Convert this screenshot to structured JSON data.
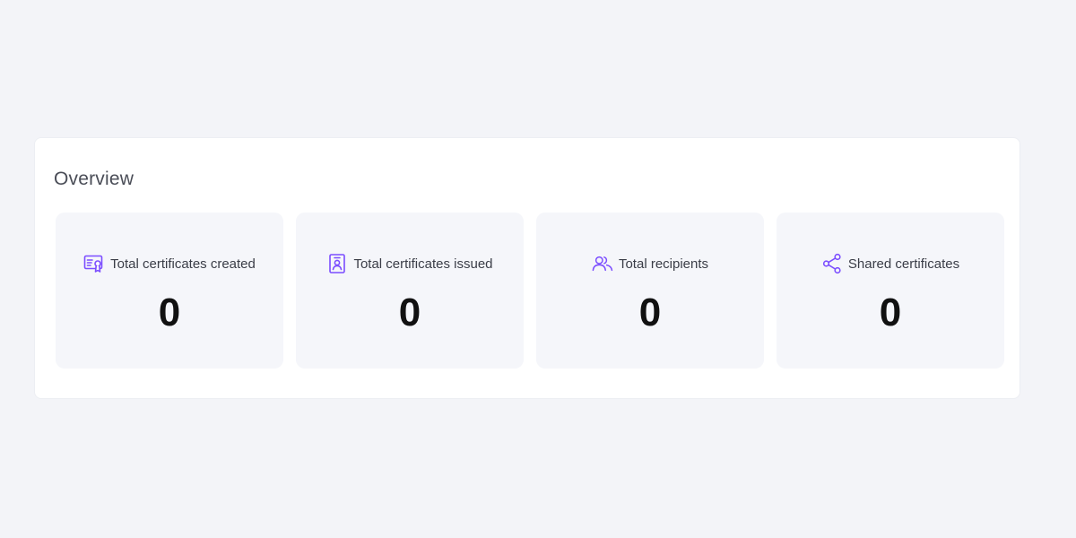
{
  "overview": {
    "title": "Overview",
    "accent_color": "#7b4dff",
    "cards": [
      {
        "icon": "certificate-icon",
        "label": "Total certificates created",
        "value": "0"
      },
      {
        "icon": "badge-icon",
        "label": "Total certificates issued",
        "value": "0"
      },
      {
        "icon": "users-icon",
        "label": "Total recipients",
        "value": "0"
      },
      {
        "icon": "share-icon",
        "label": "Shared certificates",
        "value": "0"
      }
    ]
  }
}
